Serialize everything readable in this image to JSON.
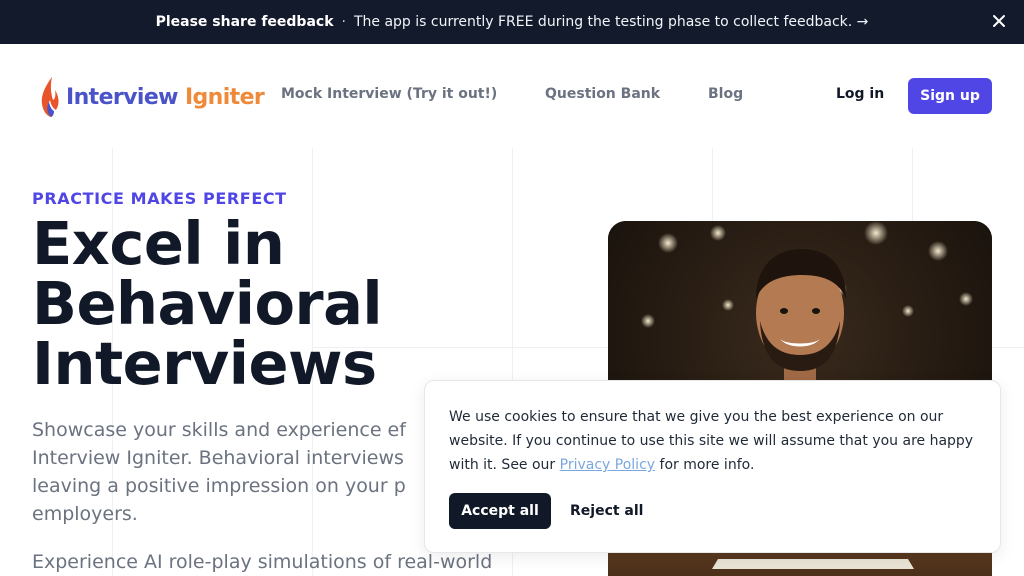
{
  "banner": {
    "title": "Please share feedback",
    "separator": "·",
    "message": "The app is currently FREE during the testing phase to collect feedback. →",
    "close_icon": "close-icon"
  },
  "header": {
    "logo": {
      "word1": "Interview",
      "word2": "Igniter",
      "icon": "flame-icon"
    },
    "nav": [
      {
        "label": "Mock Interview (Try it out!)"
      },
      {
        "label": "Question Bank"
      },
      {
        "label": "Blog"
      }
    ],
    "login_label": "Log in",
    "signup_label": "Sign up"
  },
  "hero": {
    "eyebrow": "PRACTICE MAKES PERFECT",
    "title_lines": [
      "Excel in",
      "Behavioral",
      "Interviews"
    ],
    "lede_lines": [
      "Showcase your skills and experience ef",
      "Interview Igniter. Behavioral interviews",
      "leaving a positive impression on your p",
      "employers."
    ],
    "lede2": "Experience AI role-play simulations of real-world"
  },
  "cookie": {
    "text_before_link": "We use cookies to ensure that we give you the best experience on our website. If you continue to use this site we will assume that you are happy with it. See our ",
    "link_label": "Privacy Policy",
    "text_after_link": " for more info.",
    "accept_label": "Accept all",
    "reject_label": "Reject all"
  },
  "colors": {
    "banner_bg": "#131a2c",
    "accent": "#4f46e5",
    "heading": "#111827",
    "muted": "#6b7280",
    "logo_blue": "#4a53c8",
    "logo_orange": "#ef8a3a"
  }
}
